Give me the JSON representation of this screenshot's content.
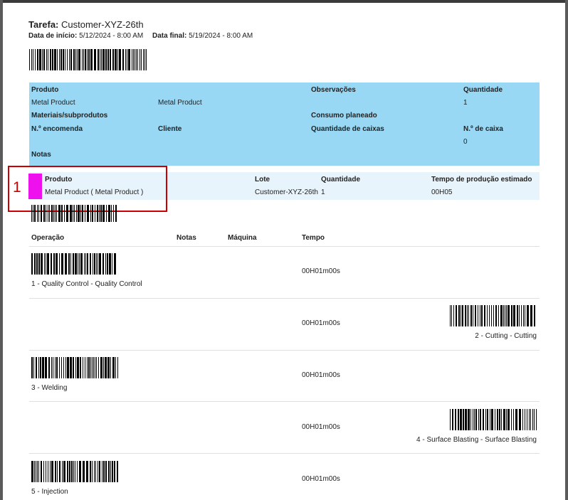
{
  "header": {
    "task_label": "Tarefa:",
    "task_value": "Customer-XYZ-26th",
    "start_label": "Data de início:",
    "start_value": "5/12/2024 - 8:00 AM",
    "end_label": "Data final:",
    "end_value": "5/19/2024 - 8:00 AM"
  },
  "info": {
    "produto_label": "Produto",
    "produto_value1": "Metal Product",
    "produto_value2": "Metal Product",
    "observacoes_label": "Observações",
    "quantidade_label": "Quantidade",
    "quantidade_value": "1",
    "materiais_label": "Materiais/subprodutos",
    "consumo_label": "Consumo planeado",
    "encomenda_label": "N.º encomenda",
    "cliente_label": "Cliente",
    "qtd_caixas_label": "Quantidade de caixas",
    "n_caixa_label": "N.º de caixa",
    "n_caixa_value": "0",
    "notas_label": "Notas"
  },
  "product_row": {
    "produto_label": "Produto",
    "produto_value": "Metal Product ( Metal Product )",
    "lote_label": "Lote",
    "lote_value": "Customer-XYZ-26th",
    "quantidade_label": "Quantidade",
    "quantidade_value": "1",
    "tempo_label": "Tempo de produção estimado",
    "tempo_value": "00H05",
    "annotation_number": "1",
    "highlight_color": "#ee11ee"
  },
  "operations": {
    "headers": {
      "operacao": "Operação",
      "notas": "Notas",
      "maquina": "Máquina",
      "tempo": "Tempo"
    },
    "rows": [
      {
        "label": "1 - Quality Control - Quality Control",
        "tempo": "00H01m00s"
      },
      {
        "label": "2 - Cutting - Cutting",
        "tempo": "00H01m00s"
      },
      {
        "label": "3 - Welding",
        "tempo": "00H01m00s"
      },
      {
        "label": "4 - Surface Blasting - Surface Blasting",
        "tempo": "00H01m00s"
      },
      {
        "label": "5 - Injection",
        "tempo": "00H01m00s"
      }
    ]
  }
}
